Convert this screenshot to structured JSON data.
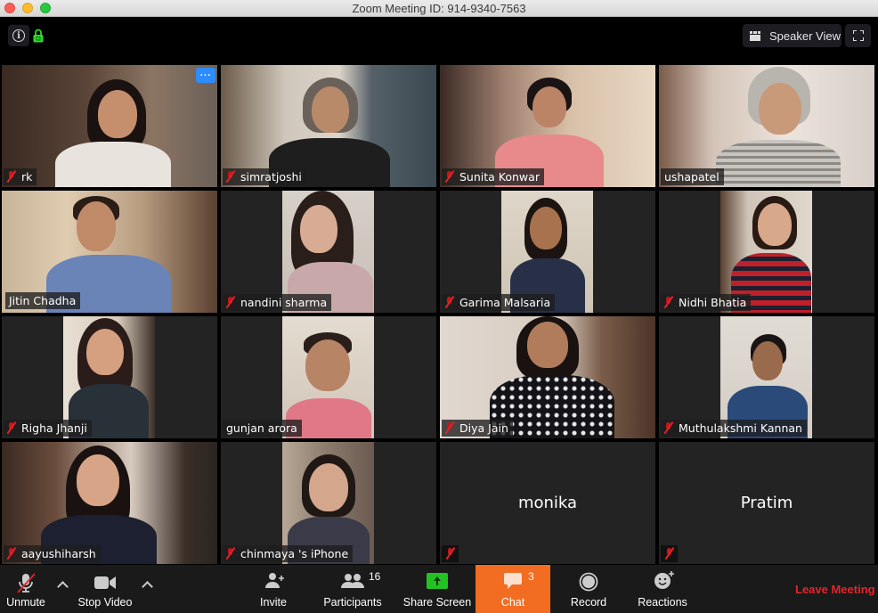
{
  "window": {
    "title": "Zoom Meeting ID: 914-9340-7563"
  },
  "topbar": {
    "info_icon": "info-icon",
    "lock_icon": "lock-icon",
    "lock_color": "#2fd62f",
    "view_button_label": "Speaker View",
    "fullscreen_icon": "fullscreen-icon"
  },
  "gallery": {
    "active_speaker_color": "#b6e35a",
    "tiles": [
      {
        "name": "rk",
        "muted": true,
        "video": true,
        "more_button": "···"
      },
      {
        "name": "simratjoshi",
        "muted": true,
        "video": true
      },
      {
        "name": "Sunita Konwar",
        "muted": true,
        "video": true
      },
      {
        "name": "ushapatel",
        "muted": false,
        "video": true
      },
      {
        "name": "Jitin Chadha",
        "muted": false,
        "video": true,
        "active_speaker": true
      },
      {
        "name": "nandini sharma",
        "muted": true,
        "video": true
      },
      {
        "name": "Garima Malsaria",
        "muted": true,
        "video": true
      },
      {
        "name": "Nidhi Bhatia",
        "muted": true,
        "video": true
      },
      {
        "name": "Righa Jhanji",
        "muted": true,
        "video": true
      },
      {
        "name": "gunjan arora",
        "muted": false,
        "video": true
      },
      {
        "name": "Diya Jain",
        "muted": true,
        "video": true
      },
      {
        "name": "Muthulakshmi Kannan",
        "muted": true,
        "video": true
      },
      {
        "name": "aayushiharsh",
        "muted": true,
        "video": true
      },
      {
        "name": "chinmaya 's iPhone",
        "muted": true,
        "video": true
      },
      {
        "name": "monika",
        "muted": true,
        "video": false
      },
      {
        "name": "Pratim",
        "muted": true,
        "video": false
      }
    ]
  },
  "toolbar": {
    "unmute_label": "Unmute",
    "stop_video_label": "Stop Video",
    "invite_label": "Invite",
    "participants_label": "Participants",
    "participants_count": "16",
    "share_screen_label": "Share Screen",
    "share_color": "#23c223",
    "chat_label": "Chat",
    "chat_count": "3",
    "chat_color": "#f26d21",
    "record_label": "Record",
    "reactions_label": "Reactions",
    "leave_label": "Leave Meeting",
    "leave_color": "#e0262b"
  }
}
